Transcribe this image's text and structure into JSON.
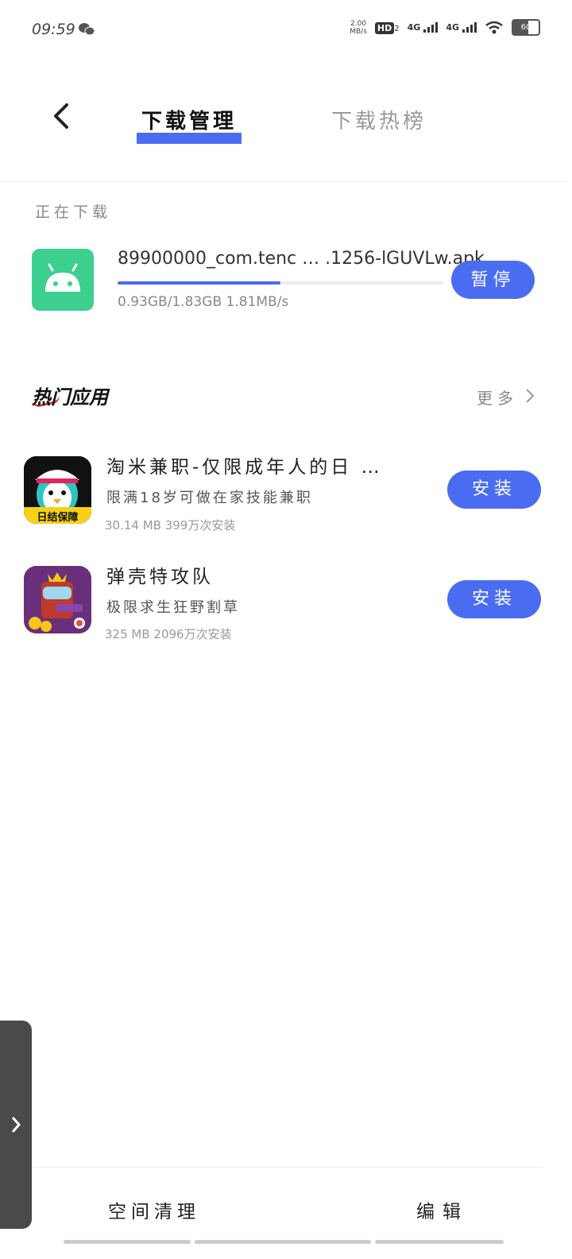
{
  "status_bar": {
    "time": "09:59",
    "net_speed_top": "2.00",
    "net_speed_bottom": "MB/s",
    "hd_badge": "HD",
    "hd_sub": "2",
    "signal1_label": "4G",
    "signal2_label": "4G",
    "battery": "60",
    "icons": [
      "wechat-icon",
      "wifi-icon"
    ]
  },
  "header": {
    "tab_active": "下载管理",
    "tab_inactive": "下载热榜"
  },
  "downloading": {
    "section_label": "正在下载",
    "file_name": "89900000_com.tenc … .1256-lGUVLw.apk",
    "progress": 0.5,
    "status_text": "0.93GB/1.83GB  1.81MB/s",
    "pause_button": "暂停"
  },
  "hot_apps": {
    "title": "热门应用",
    "more_label": "更多",
    "items": [
      {
        "name": "淘米兼职-仅限成年人的日 …",
        "desc": "限满18岁可做在家技能兼职",
        "meta": "30.14 MB   399万次安装",
        "icon_badge": "日结保障",
        "install_label": "安装"
      },
      {
        "name": "弹壳特攻队",
        "desc": "极限求生狂野割草",
        "meta": "325 MB   2096万次安装",
        "install_label": "安装"
      }
    ]
  },
  "bottom_bar": {
    "left_label": "空间清理",
    "right_label": "编辑"
  },
  "colors": {
    "accent": "#4a6cf0",
    "apk_green": "#3ccf8e"
  }
}
